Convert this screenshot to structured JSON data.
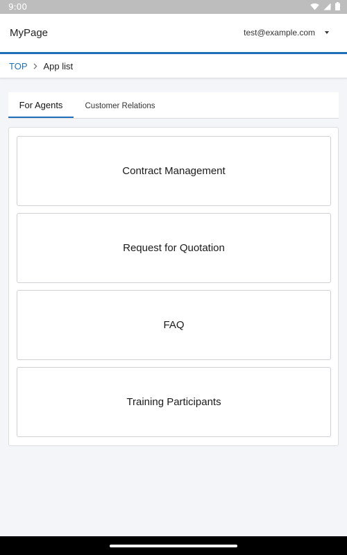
{
  "status_bar": {
    "time": "9:00",
    "icons": [
      "wifi-icon",
      "signal-icon",
      "battery-icon"
    ]
  },
  "header": {
    "title": "MyPage",
    "user_email": "test@example.com",
    "accent_color": "#1e6fb8"
  },
  "breadcrumb": {
    "home": "TOP",
    "current": "App list"
  },
  "tabs": [
    {
      "label": "For Agents",
      "active": true
    },
    {
      "label": "Customer Relations",
      "active": false
    }
  ],
  "apps": [
    {
      "label": "Contract Management"
    },
    {
      "label": "Request for Quotation"
    },
    {
      "label": "FAQ"
    },
    {
      "label": "Training Participants"
    }
  ]
}
